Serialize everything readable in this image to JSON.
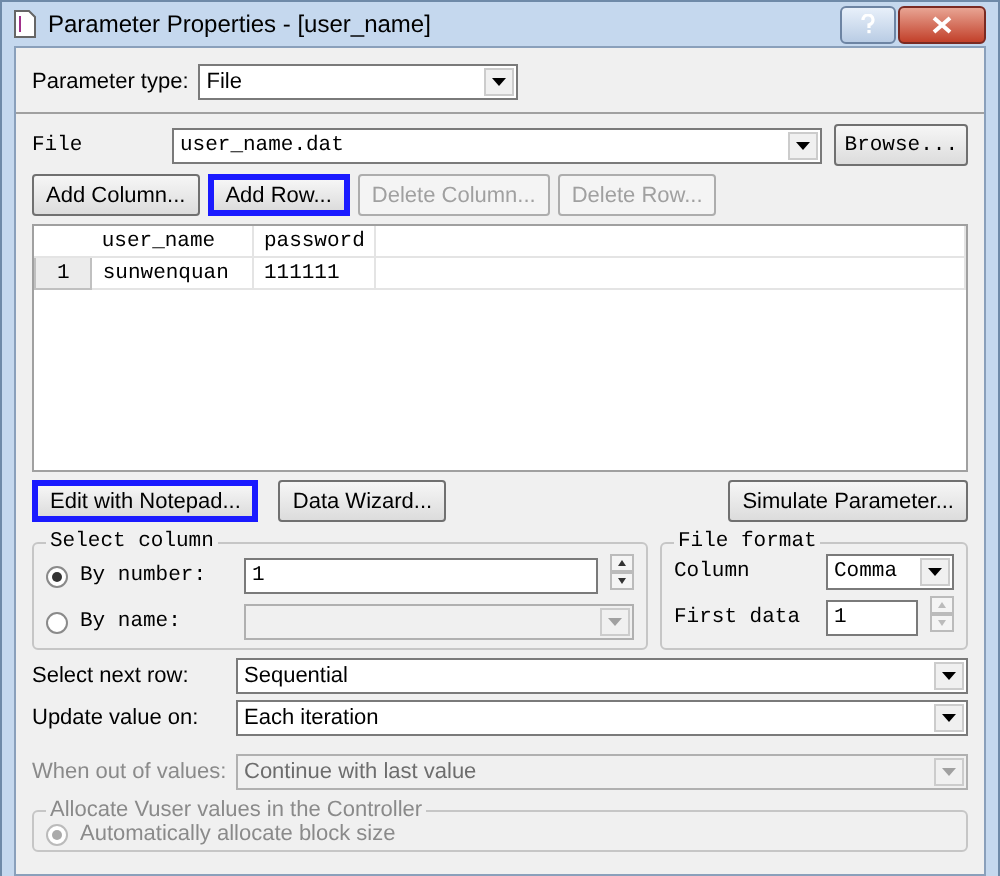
{
  "window": {
    "title": "Parameter Properties - [user_name]"
  },
  "parameter_type": {
    "label": "Parameter type:",
    "value": "File"
  },
  "file": {
    "label": "File",
    "value": "user_name.dat",
    "browse": "Browse..."
  },
  "table_buttons": [
    {
      "label": "Add Column...",
      "disabled": false,
      "highlighted": false
    },
    {
      "label": "Add Row...",
      "disabled": false,
      "highlighted": true
    },
    {
      "label": "Delete Column...",
      "disabled": true,
      "highlighted": false
    },
    {
      "label": "Delete Row...",
      "disabled": true,
      "highlighted": false
    }
  ],
  "table": {
    "columns": [
      "user_name",
      "password"
    ],
    "rows": [
      {
        "number": "1",
        "cells": [
          "sunwenquan",
          "111111"
        ]
      }
    ]
  },
  "action_buttons": [
    {
      "label": "Edit with Notepad...",
      "highlighted": true
    },
    {
      "label": "Data Wizard...",
      "highlighted": false
    }
  ],
  "simulate_button": "Simulate Parameter...",
  "select_column": {
    "title": "Select column",
    "options": [
      {
        "label": "By number:",
        "selected": true,
        "value": "1"
      },
      {
        "label": "By name:",
        "selected": false
      }
    ]
  },
  "file_format": {
    "title": "File format",
    "column_label": "Column",
    "column_value": "Comma",
    "first_data_label": "First data",
    "first_data_value": "1"
  },
  "select_next_row": {
    "label": "Select next row:",
    "value": "Sequential",
    "disabled": false
  },
  "update_value_on": {
    "label": "Update value on:",
    "value": "Each iteration",
    "disabled": false
  },
  "when_out_of_values": {
    "label": "When out of values:",
    "value": "Continue with last value",
    "disabled": true
  },
  "allocate": {
    "title": "Allocate Vuser values in the Controller",
    "disabled": true,
    "option": {
      "label": "Automatically allocate block size",
      "selected": true
    }
  }
}
